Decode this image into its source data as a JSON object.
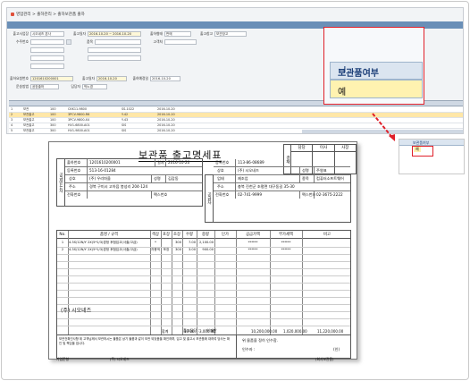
{
  "erp": {
    "breadcrumb": "영업관리 > 출하관리 > 출하보관품 출하",
    "window_title": "조회조건",
    "filters": [
      {
        "label": "출고사업장",
        "value": "시오네즈 본사"
      },
      {
        "label": "출고일자",
        "value": "2016-10-20 ~ 2016-10-20"
      },
      {
        "label": "출하형태",
        "value": "판매"
      },
      {
        "label": "출고창고",
        "value": "보관창고"
      }
    ],
    "filters2": [
      {
        "label": "수주번호",
        "value": ""
      },
      {
        "label": "품목",
        "value": ""
      },
      {
        "label": "고객처",
        "value": ""
      }
    ],
    "detail": [
      {
        "label": "출하요청번호",
        "value": "1201610200001"
      },
      {
        "label": "출고일자",
        "value": "2016-10-20"
      },
      {
        "label": "출하예정일",
        "value": "2016-10-20"
      },
      {
        "label": "운송방법",
        "value": "공장출하"
      },
      {
        "label": "담당자",
        "value": "박노경"
      }
    ],
    "rows": [
      [
        "1",
        "보관",
        "100",
        "CKK11-9800",
        "SS-1022",
        "2016-10-20"
      ],
      [
        "2",
        "보관출고",
        "100",
        "3PCV-9800-R6",
        "Y-42",
        "2016-10-20"
      ],
      [
        "3",
        "보관출고",
        "100",
        "3PCV-9800-X4",
        "Y-43",
        "2016-10-20"
      ],
      [
        "4",
        "보관출고",
        "300",
        "HV1-6800-A01",
        "SIS",
        "2016-10-20"
      ],
      [
        "5",
        "보관출고",
        "300",
        "HV1-9800-A01",
        "SIS",
        "2016-10-20"
      ],
      [
        "6",
        "보관출고",
        "300",
        "HV1-9800-A02",
        "SIS",
        "2016-10-20"
      ],
      [
        "7",
        "보관출고",
        "300",
        "HV1-6800-A03",
        "SIS",
        "2016-10-20"
      ],
      [
        "8",
        "보관출고",
        "300",
        "HV1-9800-A04",
        "SIS",
        "2016-10-20"
      ]
    ]
  },
  "zoom": {
    "header": "보관품여부",
    "value": "예"
  },
  "mini": {
    "header": "보관품여부",
    "cell": "예"
  },
  "doc": {
    "title": "보관품 출고명세표",
    "approval_label": "결재",
    "approval_cols": [
      "담당",
      "이사",
      "사장"
    ],
    "issue_no_label": "출하번호",
    "issue_no": "1201610200001",
    "date_label": "일자",
    "date": "2016-10-20",
    "receiver_side": "공급받는자",
    "supplier_side": "공급자",
    "receiver": [
      {
        "k": "등록번호",
        "v": "513-16-01284"
      },
      {
        "k": "상호",
        "v": "(주) 우리마을",
        "k2": "성명",
        "v2": "김갑동"
      },
      {
        "k": "주소",
        "v": "경북 구미시 고아읍 봉성리 204-124"
      },
      {
        "k": "전화번호",
        "v": "",
        "k2": "팩스번호",
        "v2": ""
      }
    ],
    "supplier": [
      {
        "k": "등록번호",
        "v": "113-86-08689"
      },
      {
        "k": "상호",
        "v": "(주) 시오네즈",
        "k2": "성명",
        "v2": "주영표"
      },
      {
        "k": "업태",
        "v": "제조업",
        "k2": "종목",
        "v2": "컴퓨터소프트웨어"
      },
      {
        "k": "주소",
        "v": "충북 진천군 초평면 대구동길 35-30"
      },
      {
        "k": "전화번호",
        "v": "02-741-9999",
        "k2": "팩스번호",
        "v2": "02-3675-2222"
      }
    ],
    "item_headers": [
      "No.",
      "품명 / 규격",
      "색상",
      "포장",
      "조장",
      "수량",
      "중량",
      "단가",
      "공급가액",
      "부가세액",
      "비고"
    ],
    "items": [
      [
        "1",
        "4.3S/12N/Y 2X(5*1/3)경정 후첨입고(사출/고급)",
        "*",
        "",
        "300",
        "7.00",
        "2,100.00",
        "",
        "******",
        "******",
        ""
      ],
      [
        "2",
        "4.3S/12N/Y 2X(5*1/3)경정 후첨입고(사출/고급)",
        "자몽색",
        "포장",
        "300",
        "3.00",
        "900.00",
        "",
        "******",
        "******",
        ""
      ]
    ],
    "total_label": "합계",
    "total_qty": "10.00",
    "total_weight": "3,000.00",
    "total_supply": "10,200,000.00",
    "total_vat": "1,020,000.00",
    "total_sum": "11,220,000.00",
    "company": "(주) 시오네즈",
    "note": "보관건확인사항 위 고객님께서 보관하시는 물품은 상기 물품과 같이 보관 되었음을 확인하며, 입고 및 출고시 보관품에 대하여 당사는 확인 및 책임을 집니다.",
    "receiver_title": "인수자 :",
    "received_text": "위 물품을 정히 인수함.",
    "stamp": "(인)",
    "shipper_label": "출고담당 :",
    "shipper": "이재만",
    "footer_left": "기업준형",
    "footer_mid": "(주) 시오네즈",
    "footer_right": "(회사보관용)"
  }
}
